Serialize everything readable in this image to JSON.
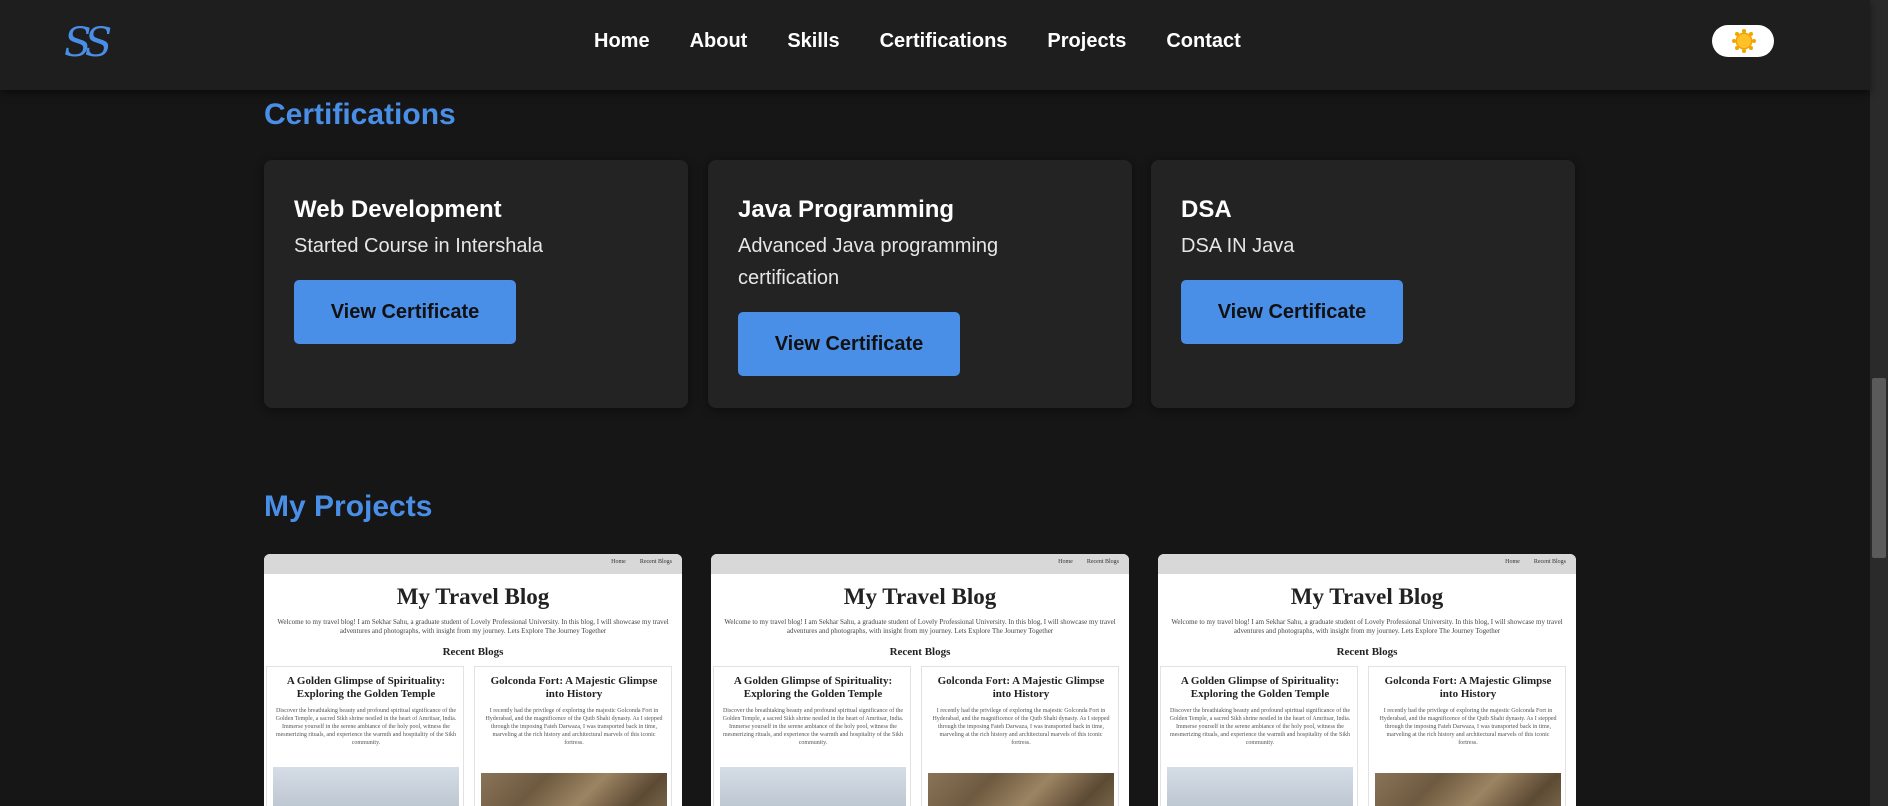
{
  "header": {
    "logo": "SS",
    "nav": [
      "Home",
      "About",
      "Skills",
      "Certifications",
      "Projects",
      "Contact"
    ],
    "theme_icon": "sun-icon",
    "accent_color": "#4a8fe7"
  },
  "certifications": {
    "title": "Certifications",
    "cards": [
      {
        "name": "Web Development",
        "description": "Started Course in Intershala",
        "button": "View Certificate"
      },
      {
        "name": "Java Programming",
        "description": "Advanced Java programming certification",
        "button": "View Certificate"
      },
      {
        "name": "DSA",
        "description": "DSA IN Java",
        "button": "View Certificate"
      }
    ]
  },
  "projects": {
    "title": "My Projects",
    "preview": {
      "mini_nav": [
        "Home",
        "Recent Blogs"
      ],
      "blog_title": "My Travel Blog",
      "intro": "Welcome to my travel blog! I am Sekhar Sahu, a graduate student of Lovely Professional University. In this blog, I will showcase my travel adventures and photographs, with insight from my journey. Lets Explore The Journey Together",
      "recent_heading": "Recent Blogs",
      "posts": [
        {
          "title": "A Golden Glimpse of Spirituality: Exploring the Golden Temple",
          "text": "Discover the breathtaking beauty and profound spiritual significance of the Golden Temple, a sacred Sikh shrine nestled in the heart of Amritsar, India. Immerse yourself in the serene ambiance of the holy pool, witness the mesmerizing rituals, and experience the warmth and hospitality of the Sikh community."
        },
        {
          "title": "Golconda Fort: A Majestic Glimpse into History",
          "text": "I recently had the privilege of exploring the majestic Golconda Fort in Hyderabad, and the magnificence of the Qutb Shahi dynasty. As I stepped through the imposing Fateh Darwaza, I was transported back in time, marveling at the rich history and architectural marvels of this iconic fortress."
        }
      ]
    }
  }
}
